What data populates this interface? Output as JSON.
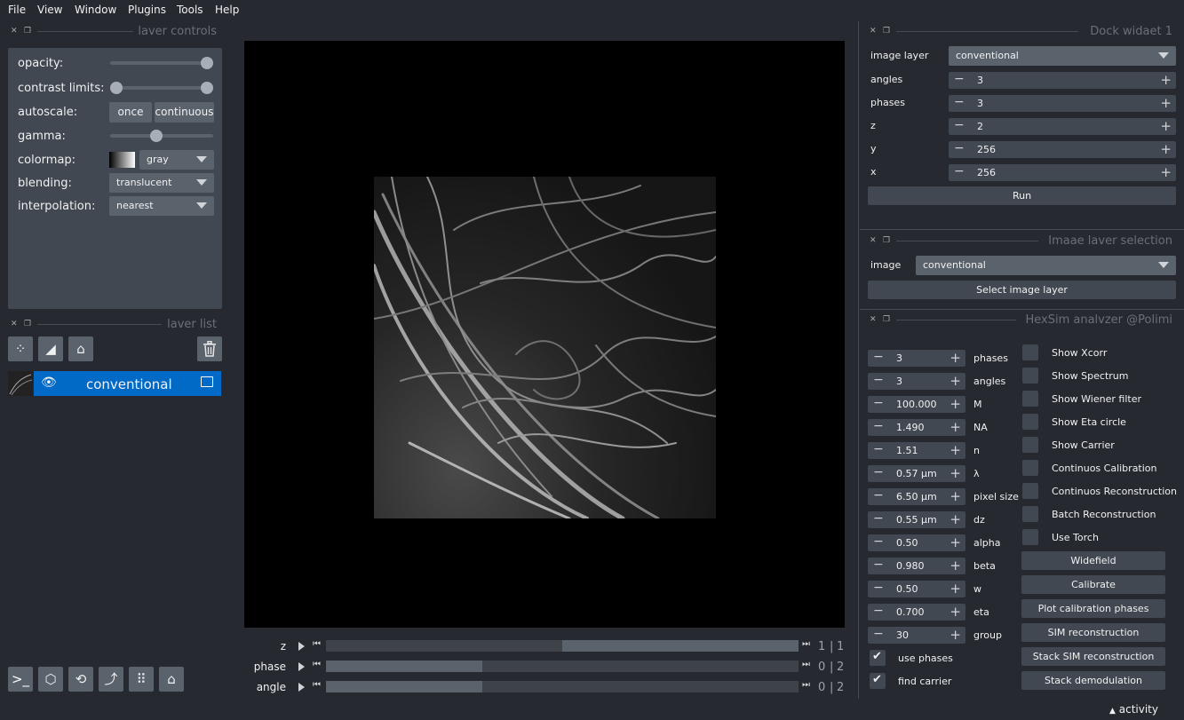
{
  "menu": [
    "File",
    "View",
    "Window",
    "Plugins",
    "Tools",
    "Help"
  ],
  "layer_controls": {
    "title": "laver controls",
    "opacity_label": "opacity:",
    "opacity": 1.0,
    "contrast_label": "contrast limits:",
    "autoscale_label": "autoscale:",
    "once_label": "once",
    "continuous_label": "continuous",
    "gamma_label": "gamma:",
    "gamma": 0.5,
    "colormap_label": "colormap:",
    "colormap": "gray",
    "blending_label": "blending:",
    "blending": "translucent",
    "interpolation_label": "interpolation:",
    "interpolation": "nearest"
  },
  "layer_list": {
    "title": "laver list",
    "layers": [
      {
        "name": "conventional"
      }
    ]
  },
  "dims": [
    {
      "label": "z",
      "value": "1",
      "max": "1",
      "fill": 0.5
    },
    {
      "label": "phase",
      "value": "0",
      "max": "2",
      "fill": 0.33
    },
    {
      "label": "angle",
      "value": "0",
      "max": "2",
      "fill": 0.33
    }
  ],
  "dock1": {
    "title": "Dock widaet 1",
    "image_layer_label": "image layer",
    "image_layer": "conventional",
    "fields": [
      {
        "label": "angles",
        "value": "3"
      },
      {
        "label": "phases",
        "value": "3"
      },
      {
        "label": "z",
        "value": "2"
      },
      {
        "label": "y",
        "value": "256"
      },
      {
        "label": "x",
        "value": "256"
      }
    ],
    "run_label": "Run"
  },
  "dock2": {
    "title": "Imaae laver selection",
    "image_label": "image",
    "image": "conventional",
    "select_label": "Select image layer"
  },
  "dock3": {
    "title": "HexSim analvzer @Polimi",
    "params": [
      {
        "value": "3",
        "label": "phases"
      },
      {
        "value": "3",
        "label": "angles"
      },
      {
        "value": "100.000",
        "label": "M"
      },
      {
        "value": "1.490",
        "label": "NA"
      },
      {
        "value": "1.51",
        "label": "n"
      },
      {
        "value": "0.57 µm",
        "label": "λ"
      },
      {
        "value": "6.50 µm",
        "label": "pixel size"
      },
      {
        "value": "0.55 µm",
        "label": "dz"
      },
      {
        "value": "0.50",
        "label": "alpha"
      },
      {
        "value": "0.980",
        "label": "beta"
      },
      {
        "value": "0.50",
        "label": "w"
      },
      {
        "value": "0.700",
        "label": "eta"
      },
      {
        "value": "30",
        "label": "group"
      }
    ],
    "use_phases_label": "use phases",
    "find_carrier_label": "find carrier",
    "checks": [
      "Show Xcorr",
      "Show Spectrum",
      "Show Wiener filter",
      "Show Eta circle",
      "Show Carrier",
      "Continuos Calibration",
      "Continuos Reconstruction",
      "Batch Reconstruction",
      "Use Torch"
    ],
    "buttons": [
      "Widefield",
      "Calibrate",
      "Plot calibration phases",
      "SIM reconstruction",
      "Stack SIM reconstruction",
      "Stack demodulation"
    ]
  },
  "activity_label": "activity"
}
